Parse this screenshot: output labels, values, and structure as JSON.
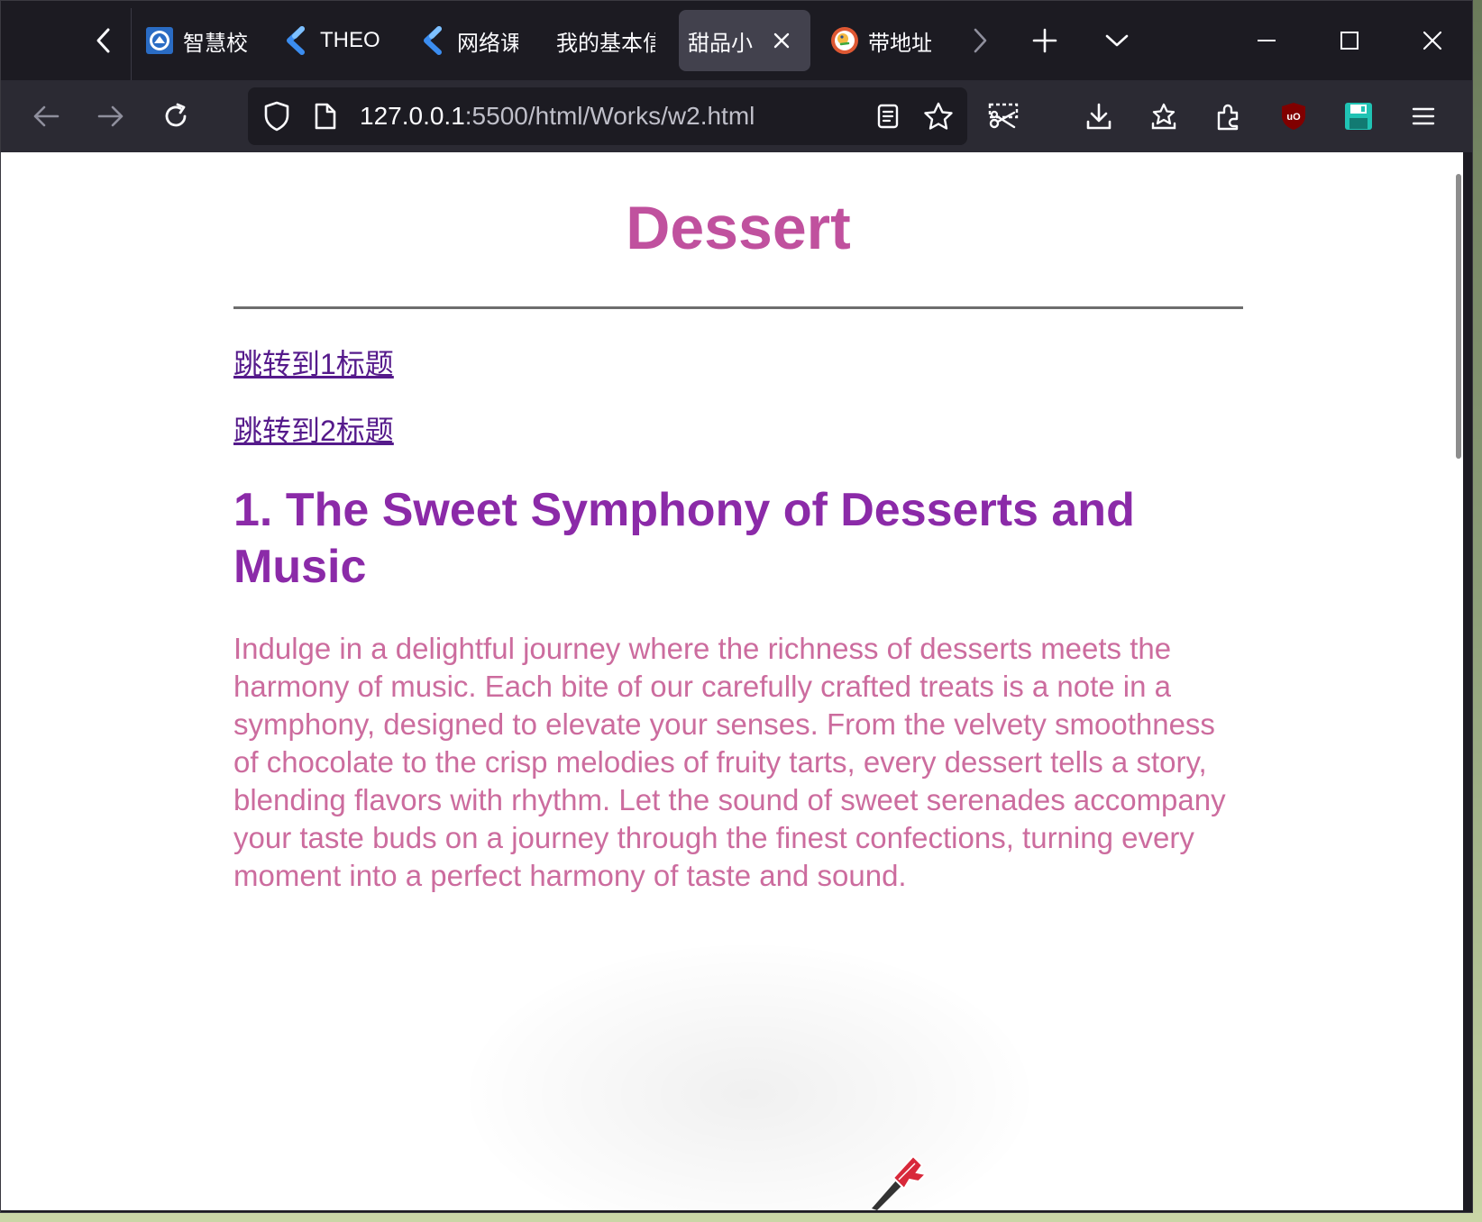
{
  "tabs": [
    {
      "title": "智慧校",
      "favicon": "university-logo-icon",
      "active": false
    },
    {
      "title": "THEO",
      "favicon": "blue-chevron-logo-icon",
      "active": false
    },
    {
      "title": "网络课",
      "favicon": "blue-chevron-logo-icon",
      "active": false
    },
    {
      "title": "我的基本信",
      "favicon": "",
      "active": false
    },
    {
      "title": "甜品小",
      "favicon": "",
      "active": true
    },
    {
      "title": "带地址",
      "favicon": "duckduckgo-icon",
      "active": false
    }
  ],
  "url": {
    "host": "127.0.0.1",
    "rest": ":5500/html/Works/w2.html"
  },
  "page": {
    "title": "Dessert",
    "links": [
      "跳转到1标题",
      "跳转到2标题"
    ],
    "heading": "1. The Sweet Symphony of Desserts and Music",
    "paragraph": "Indulge in a delightful journey where the richness of desserts meets the harmony of music. Each bite of our carefully crafted treats is a note in a symphony, designed to elevate your senses. From the velvety smoothness of chocolate to the crisp melodies of fruity tarts, every dessert tells a story, blending flavors with rhythm. Let the sound of sweet serenades accompany your taste buds on a journey through the finest confections, turning every moment into a perfect harmony of taste and sound."
  },
  "colors": {
    "title": "#c0519e",
    "heading": "#8b2aa8",
    "paragraph": "#cc6c9e",
    "link": "#551a8b",
    "tabstrip": "#1c1b22",
    "toolbar": "#2b2a33"
  }
}
